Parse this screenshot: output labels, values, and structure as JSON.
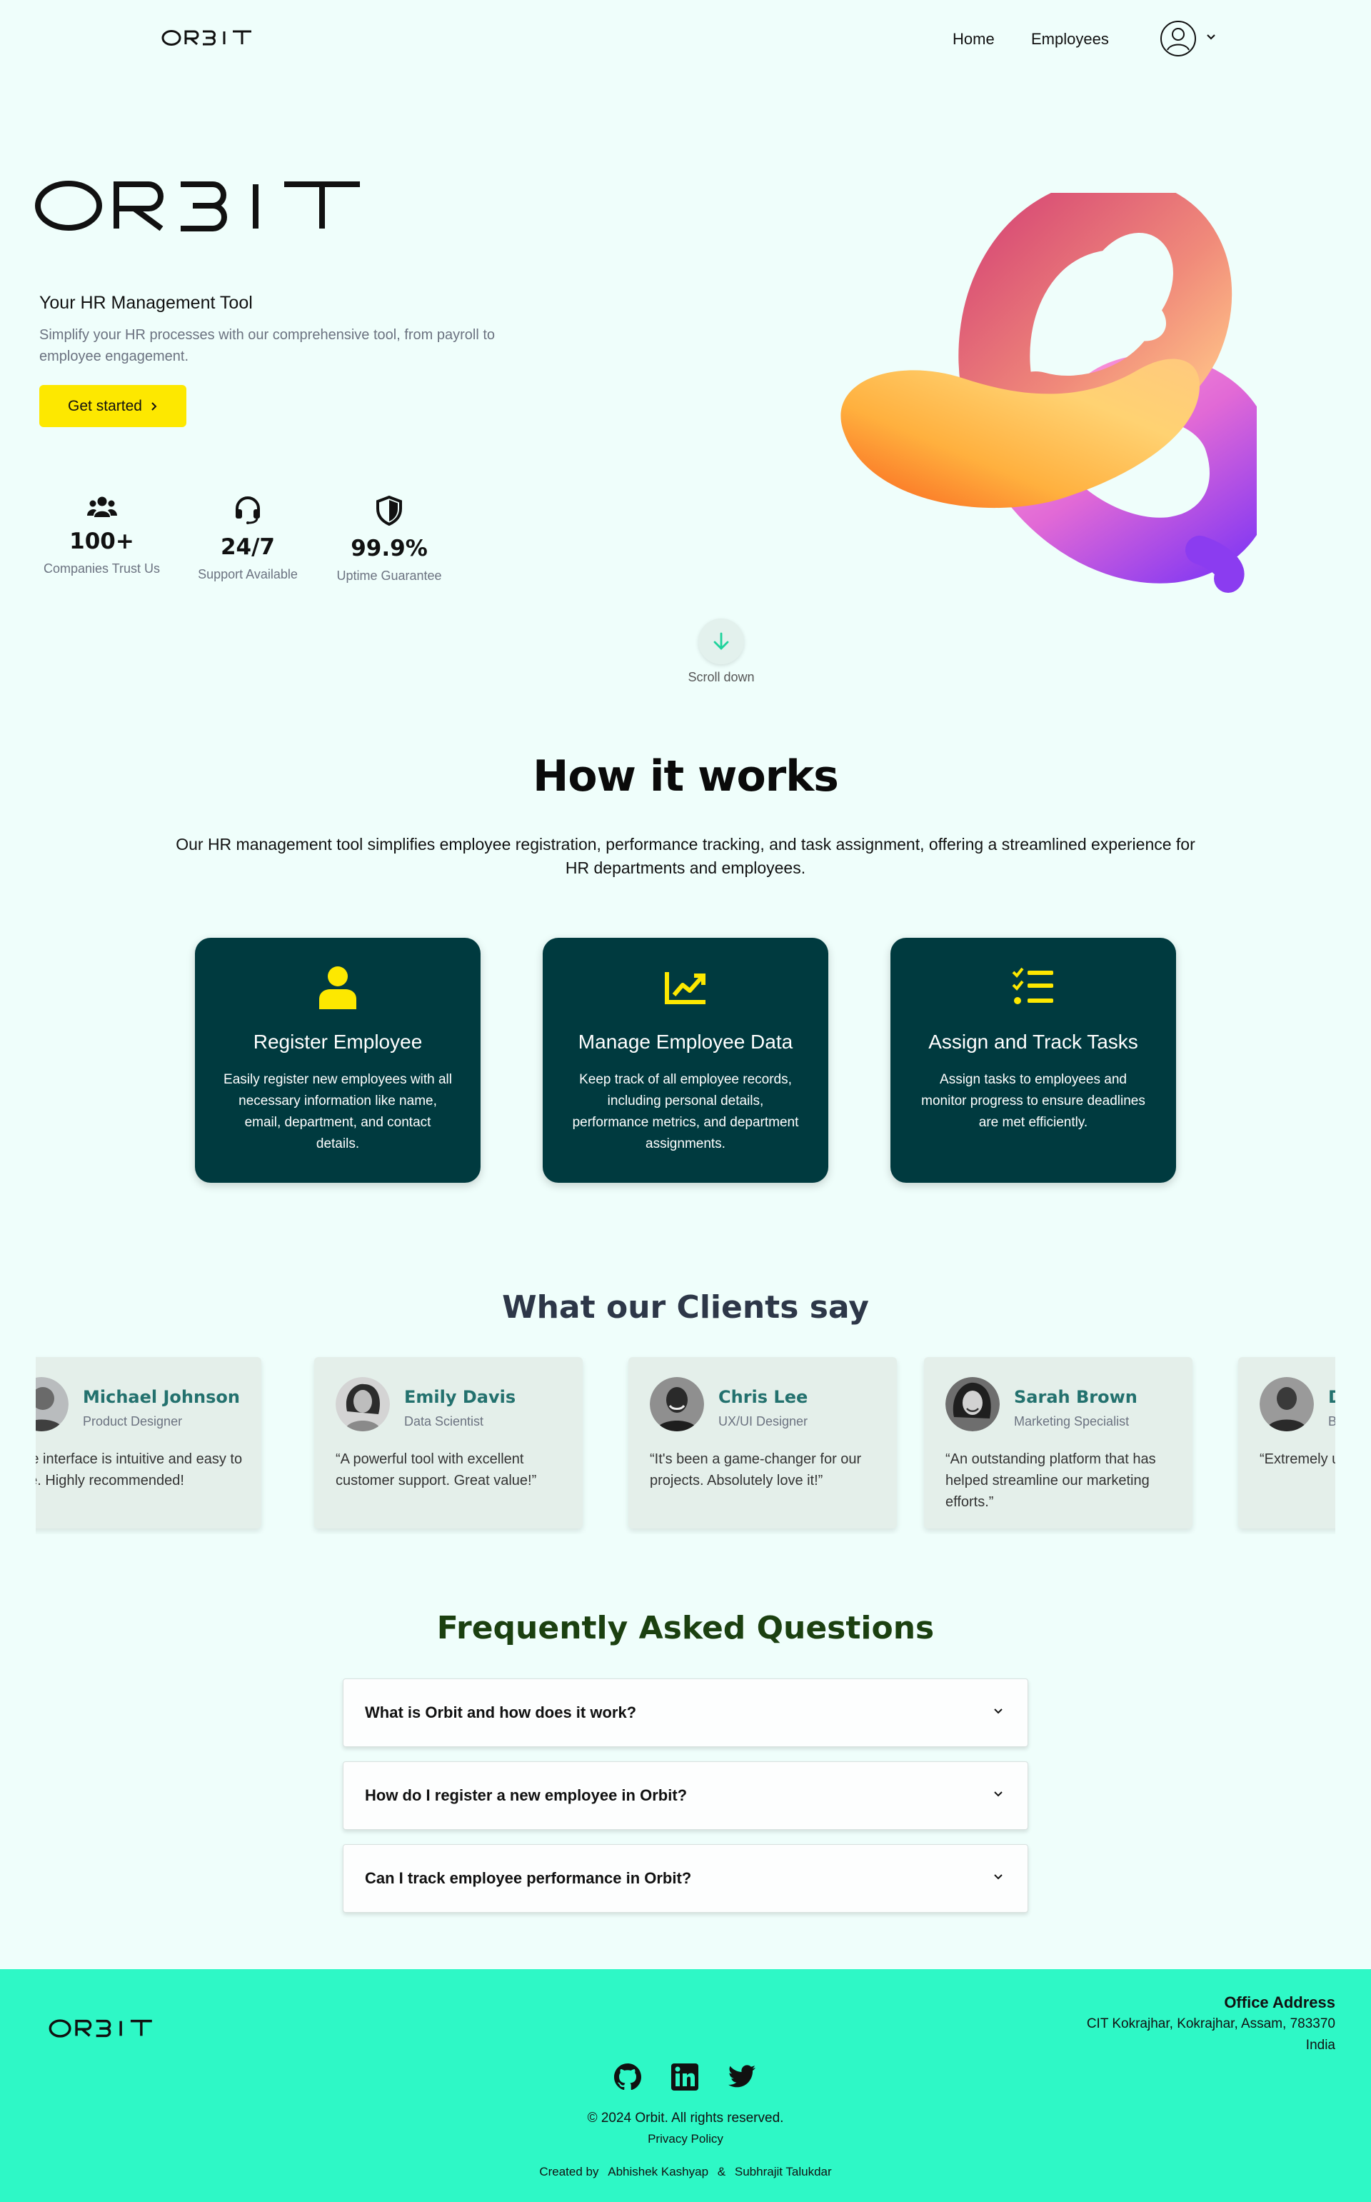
{
  "brand": {
    "logo_text": "ORBIT"
  },
  "nav": {
    "links": [
      "Home",
      "Employees"
    ],
    "icons": {
      "avatar": "user-circle-icon",
      "menu": "chevron-down-icon"
    }
  },
  "hero": {
    "subtitle": "Your HR Management Tool",
    "description": "Simplify your HR processes with our comprehensive tool, from payroll to employee engagement.",
    "cta_label": "Get started",
    "cta_icon": "chevron-right-icon",
    "stats": [
      {
        "icon": "users-icon",
        "value": "100+",
        "label": "Companies Trust Us"
      },
      {
        "icon": "headset-icon",
        "value": "24/7",
        "label": "Support Available"
      },
      {
        "icon": "shield-icon",
        "value": "99.9%",
        "label": "Uptime Guarantee"
      }
    ],
    "scroll_label": "Scroll down",
    "colors": {
      "cta_bg": "#fde800",
      "knot_orange": "#fb7c2a",
      "knot_pink": "#e9609a",
      "knot_purple": "#9b4cf0"
    }
  },
  "how": {
    "title": "How it works",
    "description": "Our HR management tool simplifies employee registration, performance tracking, and task assignment, offering a streamlined experience for HR departments and employees.",
    "cards": [
      {
        "icon": "user-icon",
        "title": "Register Employee",
        "text": "Easily register new employees with all necessary information like name, email, department, and contact details."
      },
      {
        "icon": "chart-line-icon",
        "title": "Manage Employee Data",
        "text": "Keep track of all employee records, including personal details, performance metrics, and department assignments."
      },
      {
        "icon": "task-list-icon",
        "title": "Assign and Track Tasks",
        "text": "Assign tasks to employees and monitor progress to ensure deadlines are met efficiently."
      }
    ],
    "colors": {
      "card_bg": "#003a3f",
      "icon": "#fde800"
    }
  },
  "clients": {
    "title": "What our Clients say",
    "testimonials": [
      {
        "name": "Michael Johnson",
        "role": "Product Designer",
        "quote": "The interface is intuitive and easy to use. Highly recommended!"
      },
      {
        "name": "Emily Davis",
        "role": "Data Scientist",
        "quote": "“A powerful tool with excellent customer support. Great value!”"
      },
      {
        "name": "Chris Lee",
        "role": "UX/UI Designer",
        "quote": "“It's been a game-changer for our projects. Absolutely love it!”"
      },
      {
        "name": "Sarah Brown",
        "role": "Marketing Specialist",
        "quote": "“An outstanding platform that has helped streamline our marketing efforts.”"
      },
      {
        "name": "D",
        "role": "B",
        "quote": "“Extremely use. It has we work.”"
      }
    ],
    "colors": {
      "card_bg": "#e4efea",
      "name": "#23716e"
    }
  },
  "faq": {
    "title": "Frequently Asked Questions",
    "items": [
      "What is Orbit and how does it work?",
      "How do I register a new employee in Orbit?",
      "Can I track employee performance in Orbit?"
    ],
    "icon": "chevron-down-icon",
    "colors": {
      "title": "#1b4010"
    }
  },
  "footer": {
    "office_title": "Office Address",
    "office_lines": [
      "CIT Kokrajhar, Kokrajhar, Assam, 783370",
      "India"
    ],
    "social_icons": [
      "github-icon",
      "linkedin-icon",
      "twitter-icon"
    ],
    "copyright": "© 2024 Orbit. All rights reserved.",
    "privacy": "Privacy Policy",
    "credits_prefix": "Created by",
    "author_1": "Abhishek Kashyap",
    "separator": "&",
    "author_2": "Subhrajit Talukdar",
    "colors": {
      "bg": "#2ef8c6"
    }
  }
}
